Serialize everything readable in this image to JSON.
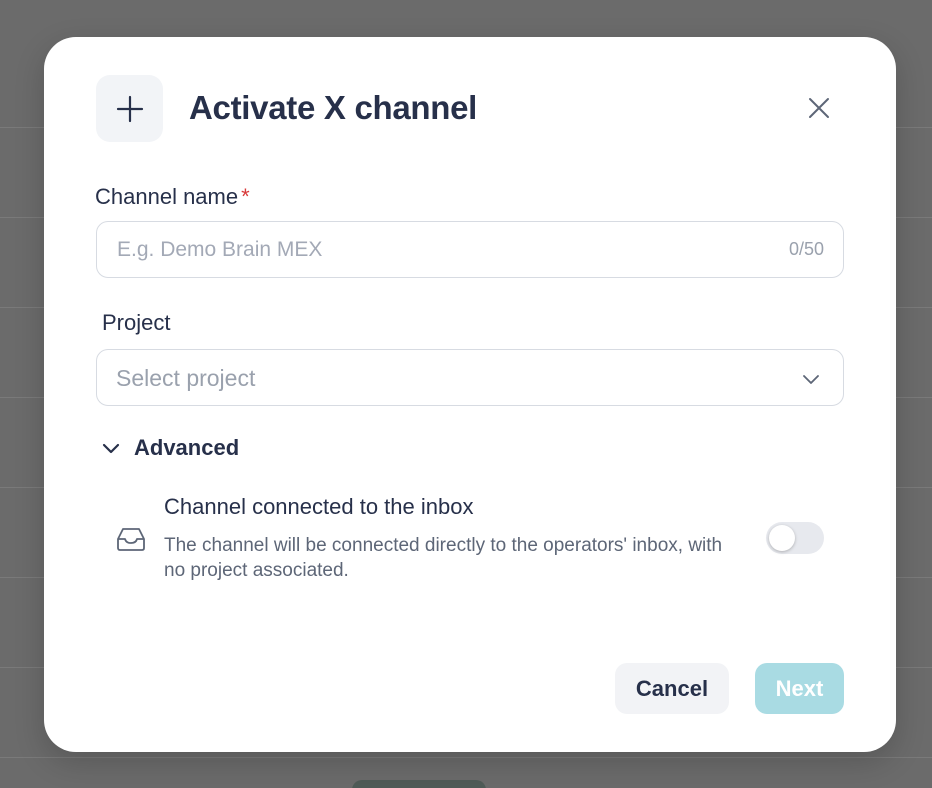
{
  "modal": {
    "title": "Activate X channel",
    "header_icon": "plus-icon",
    "close_icon": "close-icon"
  },
  "channel_name": {
    "label": "Channel name",
    "required_marker": "*",
    "placeholder": "E.g. Demo Brain MEX",
    "value": "",
    "counter": "0/50"
  },
  "project": {
    "label": "Project",
    "selected": "Select project",
    "icon": "chevron-down-icon"
  },
  "advanced": {
    "label": "Advanced",
    "expanded": true,
    "icon": "chevron-down-icon"
  },
  "inbox_option": {
    "icon": "inbox-icon",
    "title": "Channel connected to the inbox",
    "description": "The channel will be connected directly to the operators' inbox, with no project associated.",
    "enabled": false
  },
  "footer": {
    "cancel_label": "Cancel",
    "next_label": "Next",
    "next_enabled": false
  },
  "colors": {
    "title": "#27304a",
    "required": "#d83a3a",
    "next_disabled_bg": "#a9dbe3",
    "cancel_bg": "#f2f3f6",
    "backdrop": "#6b6b6b"
  }
}
